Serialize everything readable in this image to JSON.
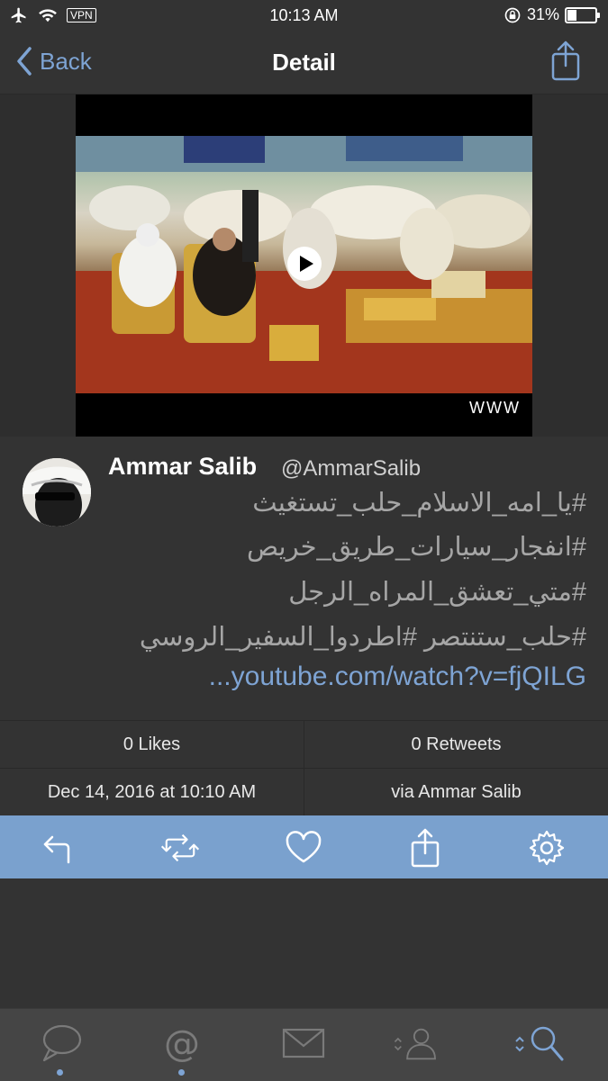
{
  "status_bar": {
    "vpn": "VPN",
    "time": "10:13 AM",
    "battery": "31%",
    "battery_level": 0.31
  },
  "nav": {
    "back_label": "Back",
    "title": "Detail"
  },
  "media": {
    "badge": "WWW"
  },
  "tweet": {
    "name": "Ammar Salib",
    "handle": "@AmmarSalib",
    "lines": [
      "#يا_امه_الاسلام_حلب_تستغيث",
      "#انفجار_سيارات_طريق_خريص",
      "#متي_تعشق_المراه_الرجل",
      "#حلب_ستنتصر #اطردوا_السفير_الروسي"
    ],
    "link": "...youtube.com/watch?v=fjQILG"
  },
  "stats": {
    "likes": "0 Likes",
    "retweets": "0 Retweets",
    "date": "Dec 14, 2016 at 10:10 AM",
    "via": "via Ammar Salib"
  },
  "actions": [
    "reply-icon",
    "retweet-icon",
    "heart-icon",
    "share-icon",
    "gear-icon"
  ],
  "tabs": [
    "speech-bubble-icon",
    "at-sign-icon",
    "envelope-icon",
    "profile-icon",
    "search-icon"
  ],
  "colors": {
    "background": "#333333",
    "accent": "#7ea4d4",
    "action_bar": "#7aa1ce",
    "tab_bar": "#454545"
  }
}
